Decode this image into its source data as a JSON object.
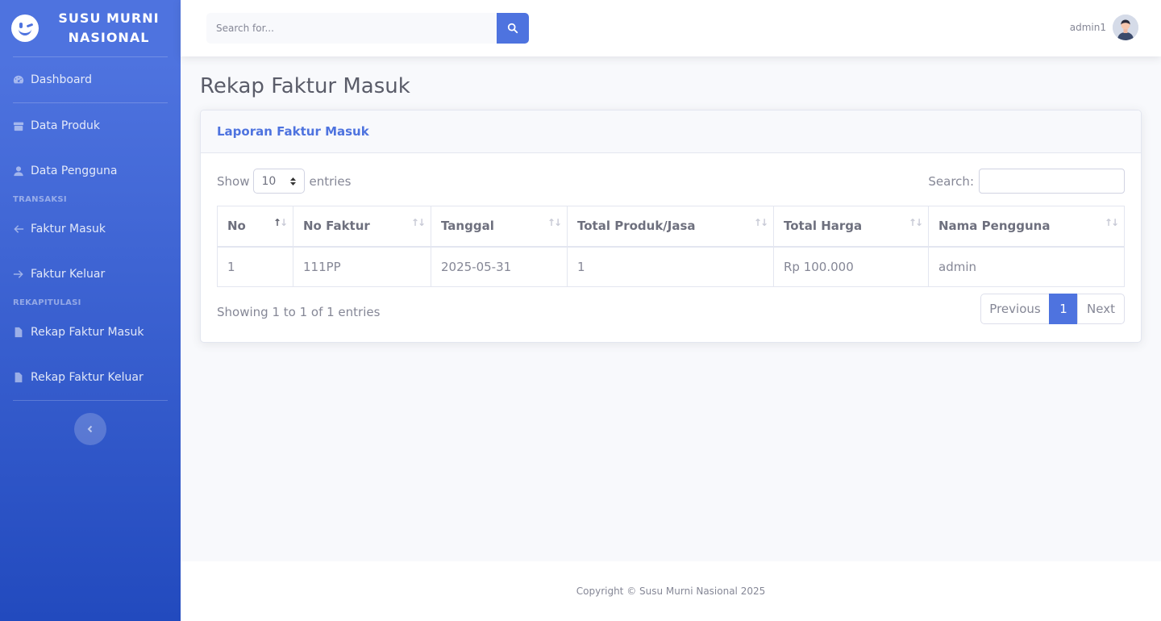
{
  "brand": {
    "line1": "SUSU MURNI",
    "line2": "NASIONAL",
    "logo_icon": "laugh-wink-icon"
  },
  "sidebar": {
    "items": [
      {
        "label": "Dashboard",
        "icon": "tachometer-icon"
      },
      {
        "label": "Data Produk",
        "icon": "box-icon"
      },
      {
        "label": "Data Pengguna",
        "icon": "user-icon"
      },
      {
        "label": "Faktur Masuk",
        "icon": "arrow-left-icon"
      },
      {
        "label": "Faktur Keluar",
        "icon": "arrow-right-icon"
      },
      {
        "label": "Rekap Faktur Masuk",
        "icon": "file-icon"
      },
      {
        "label": "Rekap Faktur Keluar",
        "icon": "file-icon"
      }
    ],
    "headings": [
      "TRANSAKSI",
      "REKAPITULASI"
    ]
  },
  "topbar": {
    "search_placeholder": "Search for...",
    "user_name": "admin1"
  },
  "page": {
    "title": "Rekap Faktur Masuk"
  },
  "card": {
    "title": "Laporan Faktur Masuk",
    "show_label": "Show",
    "entries_label": "entries",
    "page_length": "10",
    "search_label": "Search:",
    "columns": [
      "No",
      "No Faktur",
      "Tanggal",
      "Total Produk/Jasa",
      "Total Harga",
      "Nama Pengguna"
    ],
    "rows": [
      [
        "1",
        "111PP",
        "2025-05-31",
        "1",
        "Rp 100.000",
        "admin"
      ]
    ],
    "info": "Showing 1 to 1 of 1 entries",
    "pagination": {
      "previous": "Previous",
      "current": "1",
      "next": "Next"
    }
  },
  "footer": {
    "text": "Copyright © Susu Murni Nasional 2025"
  },
  "colors": {
    "primary": "#4e73df",
    "primary_dark": "#224abe",
    "text": "#858796",
    "heading": "#5a5c69"
  }
}
